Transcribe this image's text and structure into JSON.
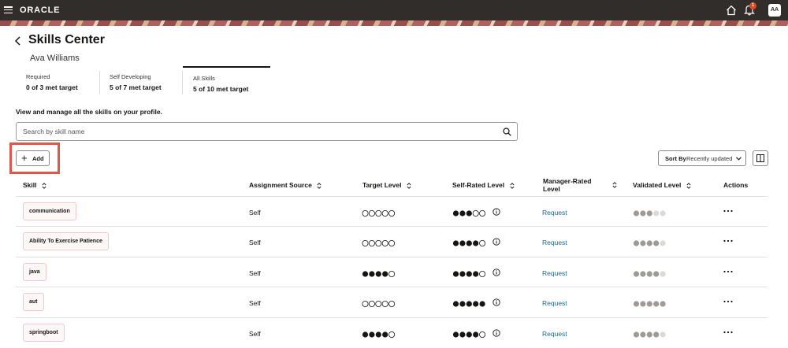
{
  "header": {
    "logo": "ORACLE",
    "notification_count": "1",
    "user_initials": "AA"
  },
  "page": {
    "title": "Skills Center",
    "person": "Ava Williams",
    "intro": "View and manage all the skills on your profile."
  },
  "stat_tabs": [
    {
      "label": "Required",
      "value": "0 of 3 met target"
    },
    {
      "label": "Self Developing",
      "value": "5 of 7 met target"
    },
    {
      "label": "All Skills",
      "value": "5 of 10 met target",
      "selected": true
    }
  ],
  "search": {
    "placeholder": "Search by skill name",
    "value": ""
  },
  "toolbar": {
    "add_label": "Add",
    "sort_prefix": "Sort By",
    "sort_value": "Recently updated"
  },
  "table": {
    "columns": {
      "skill": "Skill",
      "assignment_source": "Assignment Source",
      "target_level": "Target Level",
      "self_rated_level": "Self-Rated Level",
      "manager_rated_level": "Manager-Rated Level",
      "validated_level": "Validated Level",
      "actions": "Actions"
    },
    "rows": [
      {
        "skill": "communication",
        "source": "Self",
        "target": 0,
        "self_rated": 3,
        "manager_link": "Request",
        "validated": 3
      },
      {
        "skill": "Ability To Exercise Patience",
        "source": "Self",
        "target": 0,
        "self_rated": 4,
        "manager_link": "Request",
        "validated": 4
      },
      {
        "skill": "java",
        "source": "Self",
        "target": 4,
        "self_rated": 4,
        "manager_link": "Request",
        "validated": 4
      },
      {
        "skill": "aut",
        "source": "Self",
        "target": 0,
        "self_rated": 5,
        "manager_link": "Request",
        "validated": 5
      },
      {
        "skill": "springboot",
        "source": "Self",
        "target": 4,
        "self_rated": 4,
        "manager_link": "Request",
        "validated": 4
      }
    ]
  },
  "colors": {
    "header_bg": "#312d2a",
    "link": "#1a6b8a",
    "highlight": "#e2574c",
    "chip_border": "#f0c8c8"
  }
}
